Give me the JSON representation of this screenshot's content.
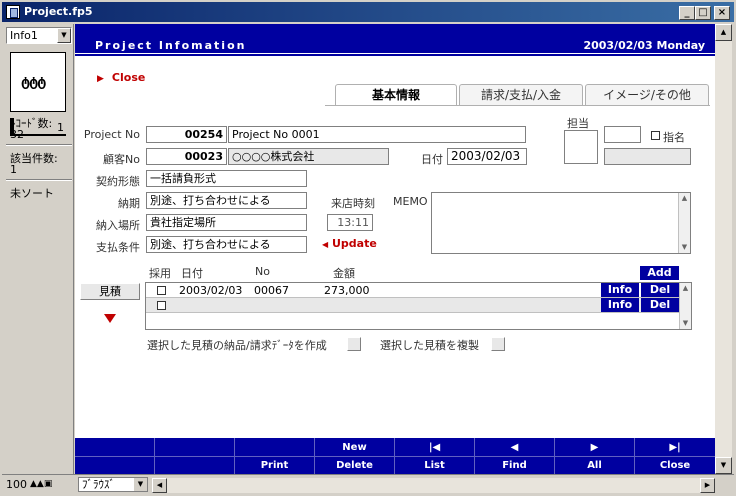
{
  "window": {
    "title": "Project.fp5",
    "minimize": "_",
    "maximize": "□",
    "close": "×"
  },
  "status": {
    "layout": "Info1",
    "record_number": "1",
    "records_label": "ﾚｺｰﾄﾞ数:",
    "records_count": "32",
    "found_label": "該当件数:",
    "found_count": "1",
    "sort_label": "未ソート"
  },
  "header": {
    "title": "Project Infomation",
    "date": "2003/02/03 Monday"
  },
  "close_link": "Close",
  "tabs": [
    {
      "label": "基本情報",
      "active": true
    },
    {
      "label": "請求/支払/入金",
      "active": false
    },
    {
      "label": "イメージ/その他",
      "active": false
    }
  ],
  "form": {
    "project_no_label": "Project No",
    "project_no": "00254",
    "project_name": "Project No 0001",
    "customer_no_label": "顧客No",
    "customer_no": "00023",
    "customer_name": "○○○○株式会社",
    "date_label": "日付",
    "date": "2003/02/03",
    "tantou_label": "担当",
    "shimei_label": "指名",
    "contract_label": "契約形態",
    "contract": "一括請負形式",
    "deadline_label": "納期",
    "deadline": "別途、打ち合わせによる",
    "visit_time_label": "来店時刻",
    "visit_time": "13:11",
    "delivery_label": "納入場所",
    "delivery": "貴社指定場所",
    "payment_label": "支払条件",
    "payment": "別途、打ち合わせによる",
    "update_link": "Update",
    "memo_label": "MEMO"
  },
  "estimates": {
    "button": "見積",
    "add": "Add",
    "columns": {
      "adopt": "採用",
      "date": "日付",
      "no": "No",
      "amount": "金額"
    },
    "rows": [
      {
        "date": "2003/02/03",
        "no": "00067",
        "amount": "273,000",
        "info": "Info",
        "del": "Del"
      },
      {
        "date": "",
        "no": "",
        "amount": "",
        "info": "Info",
        "del": "Del"
      }
    ],
    "create_label": "選択した見積の納品/請求ﾃﾞｰﾀを作成",
    "duplicate_label": "選択した見積を複製"
  },
  "toolbar": [
    {
      "top": "",
      "bottom": ""
    },
    {
      "top": "",
      "bottom": ""
    },
    {
      "top": "",
      "bottom": "Print"
    },
    {
      "top": "New",
      "bottom": "Delete"
    },
    {
      "top": "|◀",
      "bottom": "List"
    },
    {
      "top": "◀",
      "bottom": "Find"
    },
    {
      "top": "▶",
      "bottom": "All"
    },
    {
      "top": "▶|",
      "bottom": "Close"
    }
  ],
  "bottom": {
    "zoom": "100",
    "mode": "ﾌﾞﾗｳｽﾞ"
  }
}
